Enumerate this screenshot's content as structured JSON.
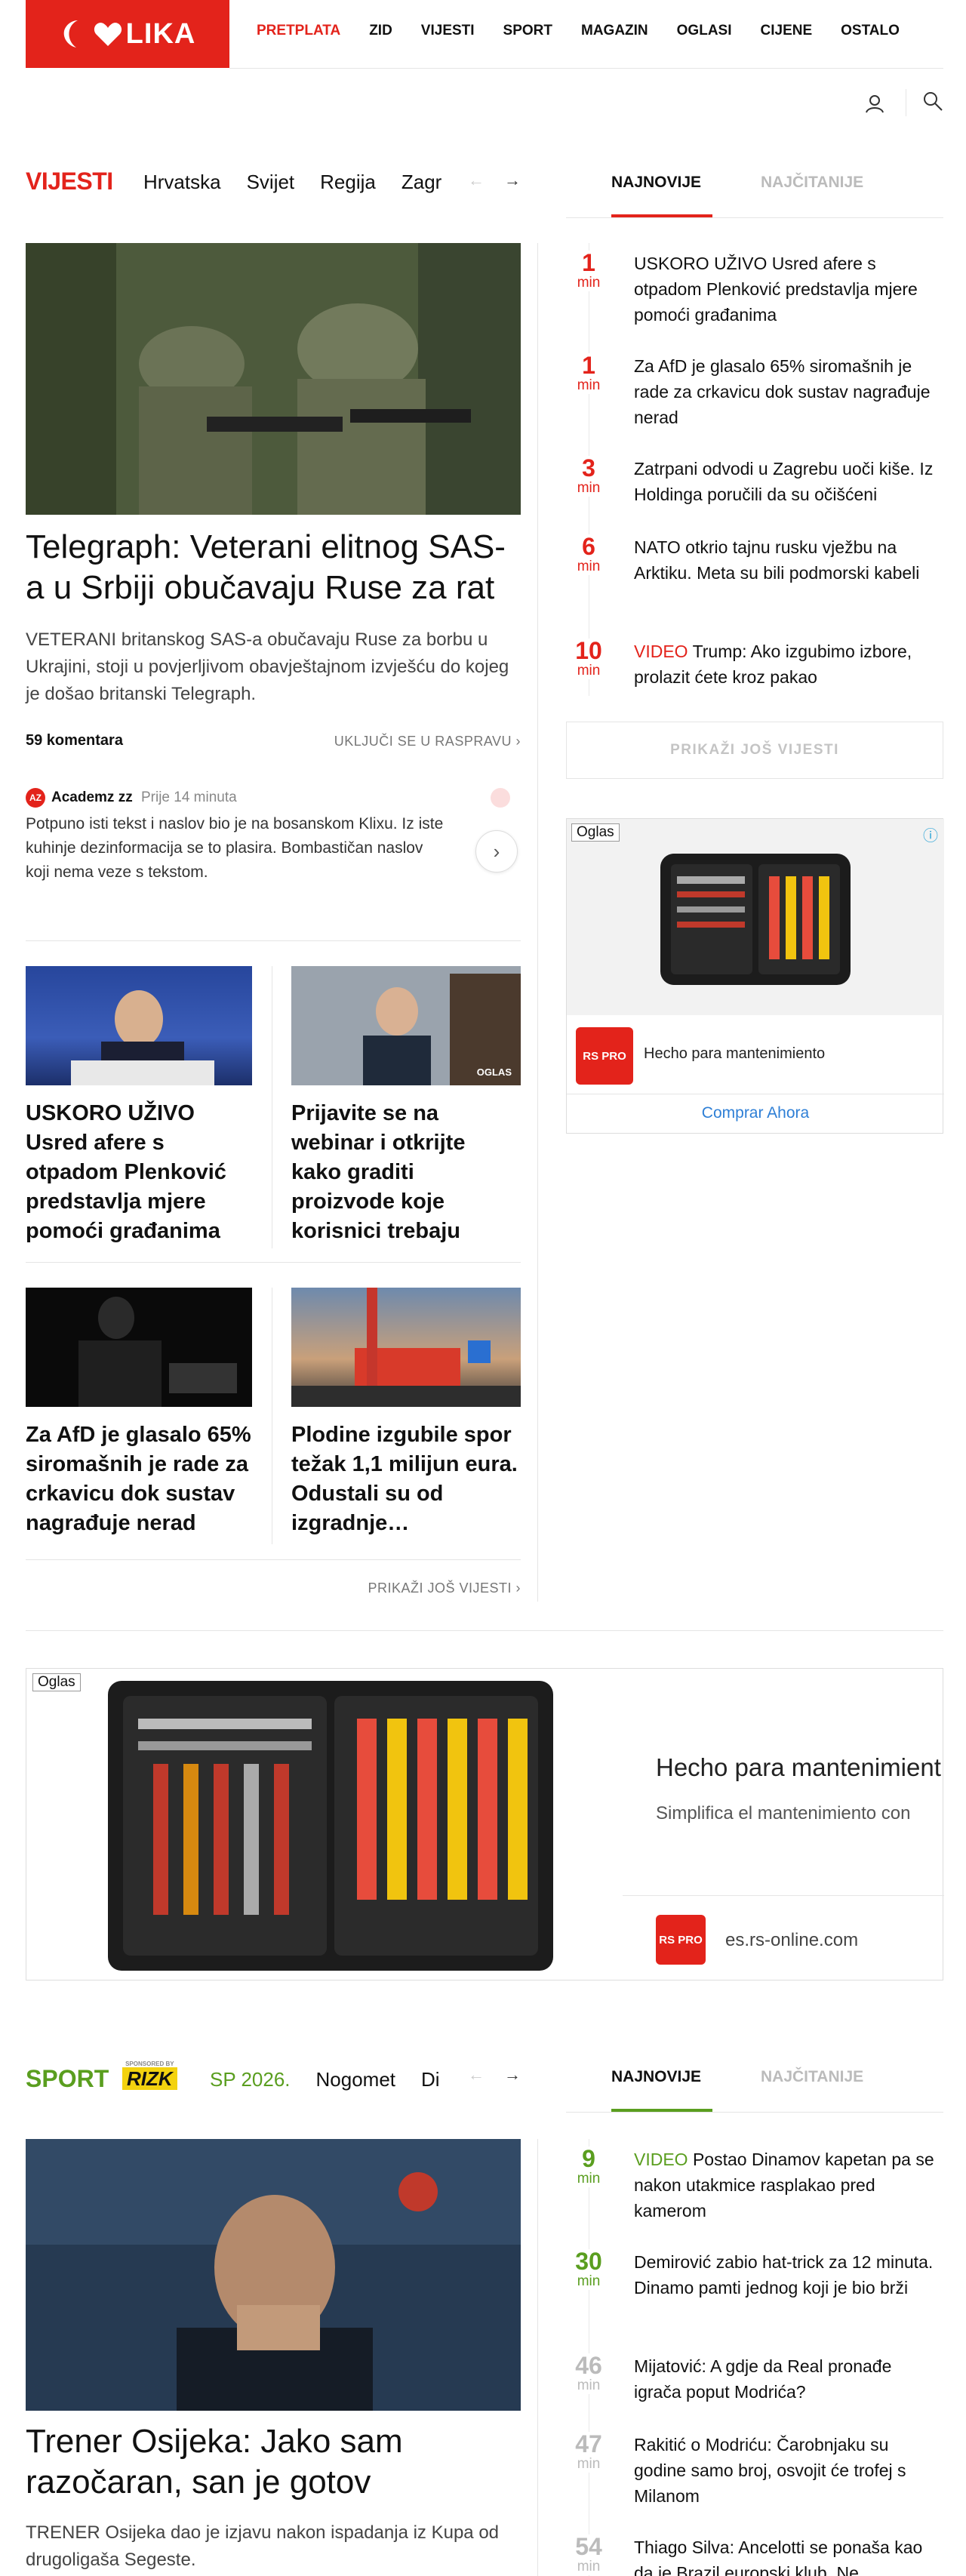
{
  "brand": {
    "name": "LIKA",
    "accent": "#e3231b",
    "sport_accent": "#5a9e1f"
  },
  "topnav": [
    "PRETPLATA",
    "ZID",
    "VIJESTI",
    "SPORT",
    "MAGAZIN",
    "OGLASI",
    "CIJENE",
    "OSTALO"
  ],
  "icons": {
    "user": "user-icon",
    "search": "search-icon"
  },
  "news": {
    "title": "VIJESTI",
    "tabs": [
      "Hrvatska",
      "Svijet",
      "Regija",
      "Zagr"
    ],
    "rail_tabs": [
      "NAJNOVIJE",
      "NAJČITANIJE"
    ],
    "lead": {
      "headline": "Telegraph: Veterani elitnog SAS-a u Srbiji obučavaju Ruse za rat",
      "lede": "VETERANI britanskog SAS-a obučavaju Ruse za borbu u Ukrajini, stoji u povjerljivom obavještajnom izvješću do kojeg je došao britanski Telegraph.",
      "comments": "59 komentara",
      "join": "UKLJUČI SE U RASPRAVU",
      "comment": {
        "avatar": "AZ",
        "author": "Academz zz",
        "time": "Prije 14 minuta",
        "text": "Potpuno isti tekst i naslov bio je na bosanskom Klixu. Iz iste kuhinje dezinformacija se to plasira. Bombastičan naslov koji nema veze s tekstom."
      }
    },
    "cards": [
      {
        "title": "USKORO UŽIVO Usred afere s otpadom Plenković predstavlja mjere pomoći građanima",
        "badge": ""
      },
      {
        "title": "Prijavite se na webinar i otkrijte kako graditi proizvode koje korisnici trebaju",
        "badge": "OGLAS"
      },
      {
        "title": "Za AfD je glasalo 65% siromašnih je rade za crkavicu dok sustav nagrađuje nerad",
        "badge": ""
      },
      {
        "title": "Plodine izgubile spor težak 1,1 milijun eura. Odustali su od izgradnje…",
        "badge": ""
      }
    ],
    "more": "PRIKAŽI JOŠ VIJESTI",
    "rail": [
      {
        "num": "1",
        "unit": "min",
        "video": "",
        "text": "USKORO UŽIVO Usred afere s otpadom Plenković predstavlja mjere pomoći građanima"
      },
      {
        "num": "1",
        "unit": "min",
        "video": "",
        "text": "Za AfD je glasalo 65% siromašnih je rade za crkavicu dok sustav nagrađuje nerad"
      },
      {
        "num": "3",
        "unit": "min",
        "video": "",
        "text": "Zatrpani odvodi u Zagrebu uoči kiše. Iz Holdinga poručili da su očišćeni"
      },
      {
        "num": "6",
        "unit": "min",
        "video": "",
        "text": "NATO otkrio tajnu rusku vježbu na Arktiku. Meta su bili podmorski kabeli"
      },
      {
        "num": "10",
        "unit": "min",
        "video": "VIDEO",
        "text": "Trump: Ako izgubimo izbore, prolazit ćete kroz pakao"
      }
    ],
    "rail_more": "PRIKAŽI JOŠ VIJESTI"
  },
  "ad_small": {
    "label": "Oglas",
    "headline": "Hecho para mantenimiento",
    "cta": "Comprar Ahora",
    "logo": "RS PRO"
  },
  "ad_wide": {
    "label": "Oglas",
    "headline": "Hecho para mantenimient",
    "sub": "Simplifica el mantenimiento con",
    "domain": "es.rs-online.com",
    "logo": "RS PRO"
  },
  "sport": {
    "title": "SPORT",
    "sponsor_small": "SPONSORED BY",
    "sponsor": "RIZK",
    "tabs": [
      "SP 2026.",
      "Nogomet",
      "Di"
    ],
    "rail_tabs": [
      "NAJNOVIJE",
      "NAJČITANIJE"
    ],
    "lead": {
      "headline": "Trener Osijeka: Jako sam razočaran, san je gotov",
      "lede": "TRENER Osijeka dao je izjavu nakon ispadanja iz Kupa od drugoligaša Segeste."
    },
    "rail": [
      {
        "num": "9",
        "unit": "min",
        "video": "VIDEO",
        "text": "Postao Dinamov kapetan pa se nakon utakmice rasplakao pred kamerom"
      },
      {
        "num": "30",
        "unit": "min",
        "video": "",
        "text": "Demirović zabio hat-trick za 12 minuta. Dinamo pamti jednog koji je bio brži"
      },
      {
        "num": "46",
        "unit": "min",
        "video": "",
        "text": "Mijatović: A gdje da Real pronađe igrača poput Modrića?"
      },
      {
        "num": "47",
        "unit": "min",
        "video": "",
        "text": "Rakitić o Modriću: Čarobnjaku su godine samo broj, osvojit će trofej s Milanom"
      },
      {
        "num": "54",
        "unit": "min",
        "video": "",
        "text": "Thiago Silva: Ancelotti se ponaša kao da je Brazil europski klub. Ne"
      }
    ]
  }
}
